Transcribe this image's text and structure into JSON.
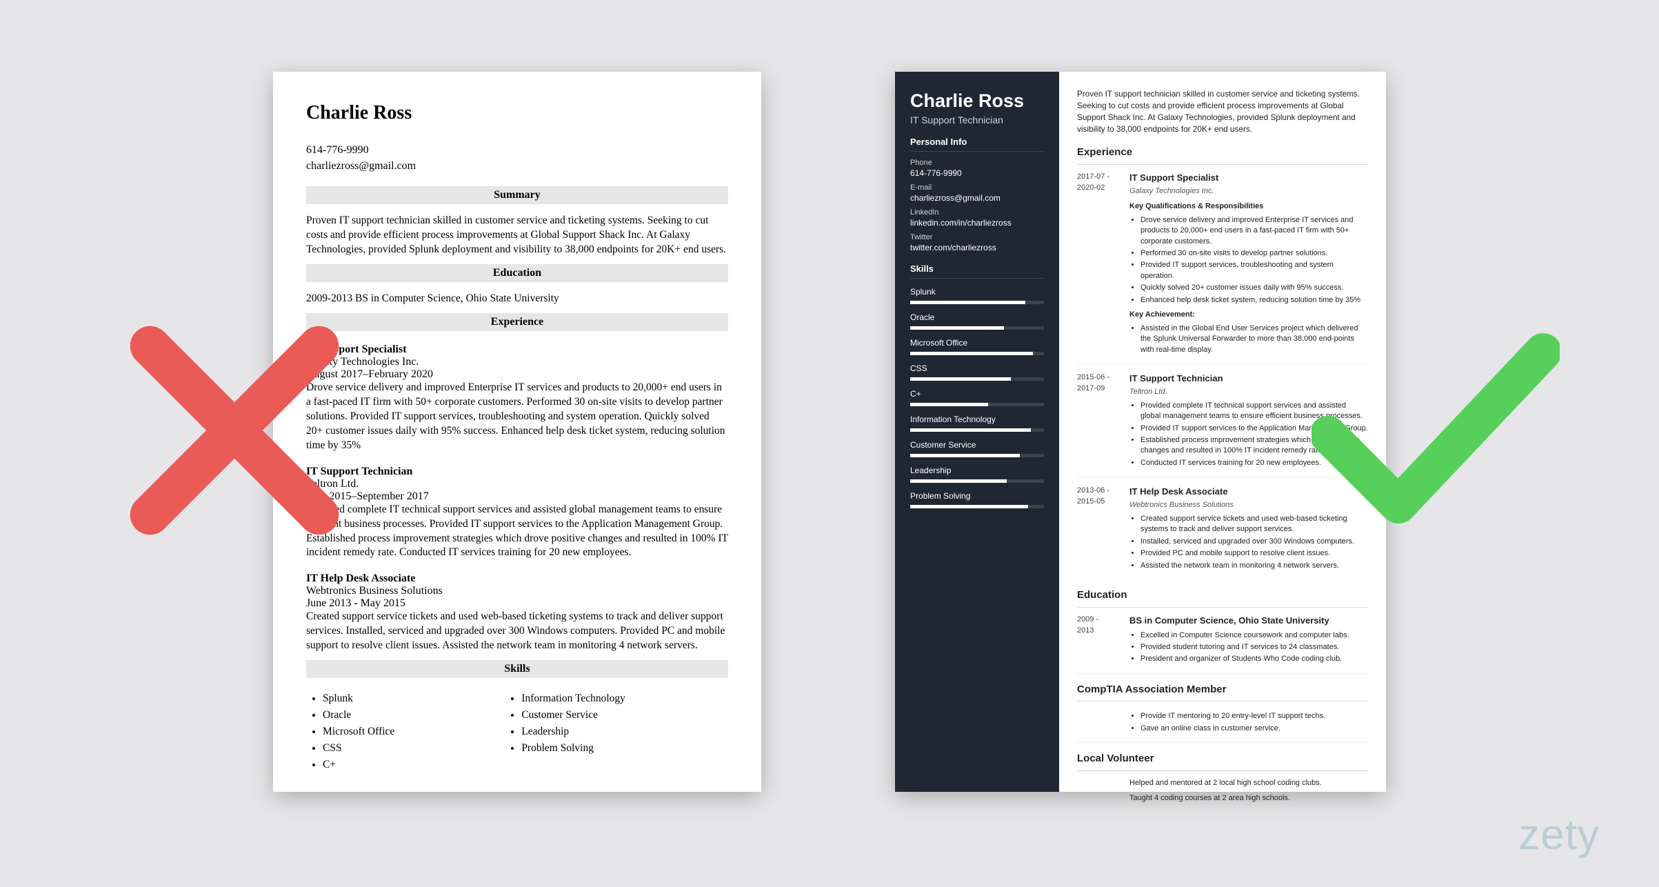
{
  "brand": "zety",
  "left": {
    "name": "Charlie Ross",
    "phone": "614-776-9990",
    "email": "charliezross@gmail.com",
    "sections": {
      "summary_title": "Summary",
      "summary": "Proven IT support technician skilled in customer service and ticketing systems. Seeking to cut costs and provide efficient process improvements at Global Support Shack Inc. At Galaxy Technologies, provided Splunk deployment and visibility to 38,000 endpoints for 20K+ end users.",
      "education_title": "Education",
      "education": "2009-2013 BS in Computer Science, Ohio State University",
      "experience_title": "Experience",
      "skills_title": "Skills"
    },
    "jobs": [
      {
        "title": "IT Support Specialist",
        "company": "Galaxy Technologies Inc.",
        "dates": "August 2017–February 2020",
        "body": "Drove service delivery and improved Enterprise IT services and products to 20,000+ end users in a fast-paced IT firm with 50+ corporate customers. Performed 30 on-site visits to develop partner solutions. Provided IT support services, troubleshooting and system operation. Quickly solved 20+ customer issues daily with 95% success. Enhanced help desk ticket system, reducing solution time by 35%"
      },
      {
        "title": "IT Support Technician",
        "company": "Teltron Ltd.",
        "dates": "June 2015–September 2017",
        "body": "Provided complete IT technical support services and assisted global management teams to ensure efficient business processes. Provided IT support services to the Application Management Group. Established process improvement strategies which drove positive changes and resulted in 100% IT incident remedy rate. Conducted IT services training for 20 new employees."
      },
      {
        "title": "IT Help Desk Associate",
        "company": "Webtronics Business Solutions",
        "dates": "June 2013 - May 2015",
        "body": "Created support service tickets and used web-based ticketing systems to track and deliver support services. Installed, serviced and upgraded over 300 Windows computers. Provided PC and mobile support to resolve client issues. Assisted the network team in monitoring 4 network servers."
      }
    ],
    "skills_col1": [
      "Splunk",
      "Oracle",
      "Microsoft Office",
      "CSS",
      "C+"
    ],
    "skills_col2": [
      "Information Technology",
      "Customer Service",
      "Leadership",
      "Problem Solving"
    ]
  },
  "right": {
    "name": "Charlie Ross",
    "role": "IT Support Technician",
    "sidebar": {
      "personal_title": "Personal Info",
      "phone_label": "Phone",
      "phone": "614-776-9990",
      "email_label": "E-mail",
      "email": "charliezross@gmail.com",
      "linkedin_label": "LinkedIn",
      "linkedin": "linkedin.com/in/charliezross",
      "twitter_label": "Twitter",
      "twitter": "twitter.com/charliezross",
      "skills_title": "Skills",
      "skills": [
        {
          "name": "Splunk",
          "pct": 86
        },
        {
          "name": "Oracle",
          "pct": 70
        },
        {
          "name": "Microsoft Office",
          "pct": 92
        },
        {
          "name": "CSS",
          "pct": 75
        },
        {
          "name": "C+",
          "pct": 58
        },
        {
          "name": "Information Technology",
          "pct": 90
        },
        {
          "name": "Customer Service",
          "pct": 82
        },
        {
          "name": "Leadership",
          "pct": 72
        },
        {
          "name": "Problem Solving",
          "pct": 88
        }
      ]
    },
    "summary": "Proven IT support technician skilled in customer service and ticketing systems. Seeking to cut costs and provide efficient process improvements at Global Support Shack Inc. At Galaxy Technologies, provided Splunk deployment and visibility to 38,000 endpoints for 20K+ end users.",
    "experience_title": "Experience",
    "education_title": "Education",
    "jobs": [
      {
        "dates": "2017-07 - 2020-02",
        "title": "IT Support Specialist",
        "company": "Galaxy Technologies Inc.",
        "sub1": "Key Qualifications & Responsibilities",
        "bullets1": [
          "Drove service delivery and improved Enterprise IT services and products to 20,000+ end users in a fast-paced IT firm with 50+ corporate customers.",
          "Performed 30 on-site visits to develop partner solutions.",
          "Provided IT support services, troubleshooting and system operation.",
          "Quickly solved 20+ customer issues daily with 95% success.",
          "Enhanced help desk ticket system, reducing solution time by 35%"
        ],
        "sub2": "Key Achievement:",
        "bullets2": [
          "Assisted in the Global End User Services project which delivered the Splunk Universal Forwarder to more than 38,000 end-points with real-time display."
        ]
      },
      {
        "dates": "2015-06 - 2017-09",
        "title": "IT Support Technician",
        "company": "Teltron Ltd.",
        "bullets1": [
          "Provided complete IT technical support services and assisted global management teams to ensure efficient business processes.",
          "Provided IT support services to the Application Management Group.",
          "Established process improvement strategies which drove positive changes and resulted in 100% IT incident remedy rate.",
          "Conducted IT services training for 20 new employees."
        ]
      },
      {
        "dates": "2013-06 - 2015-05",
        "title": "IT Help Desk Associate",
        "company": "Webtronics Business Solutions",
        "bullets1": [
          "Created support service tickets and used web-based ticketing systems to track and deliver support services.",
          "Installed, serviced and upgraded over 300 Windows computers.",
          "Provided PC and mobile support to resolve client issues.",
          "Assisted the network team in monitoring 4 network servers."
        ]
      }
    ],
    "education": {
      "dates": "2009 - 2013",
      "title": "BS in Computer Science, Ohio State University",
      "bullets": [
        "Excelled in Computer Science coursework and computer labs.",
        "Provided student tutoring and IT services to 24 classmates.",
        "President and organizer of Students Who Code coding club."
      ]
    },
    "assoc_title": "CompTIA Association Member",
    "assoc_bullets": [
      "Provide IT mentoring to 20 entry-level IT support techs.",
      "Gave an online class in customer service."
    ],
    "vol_title": "Local Volunteer",
    "vol_lines": [
      "Helped and mentored at 2 local high school coding clubs.",
      "Taught 4 coding courses at 2 area high schools."
    ]
  }
}
